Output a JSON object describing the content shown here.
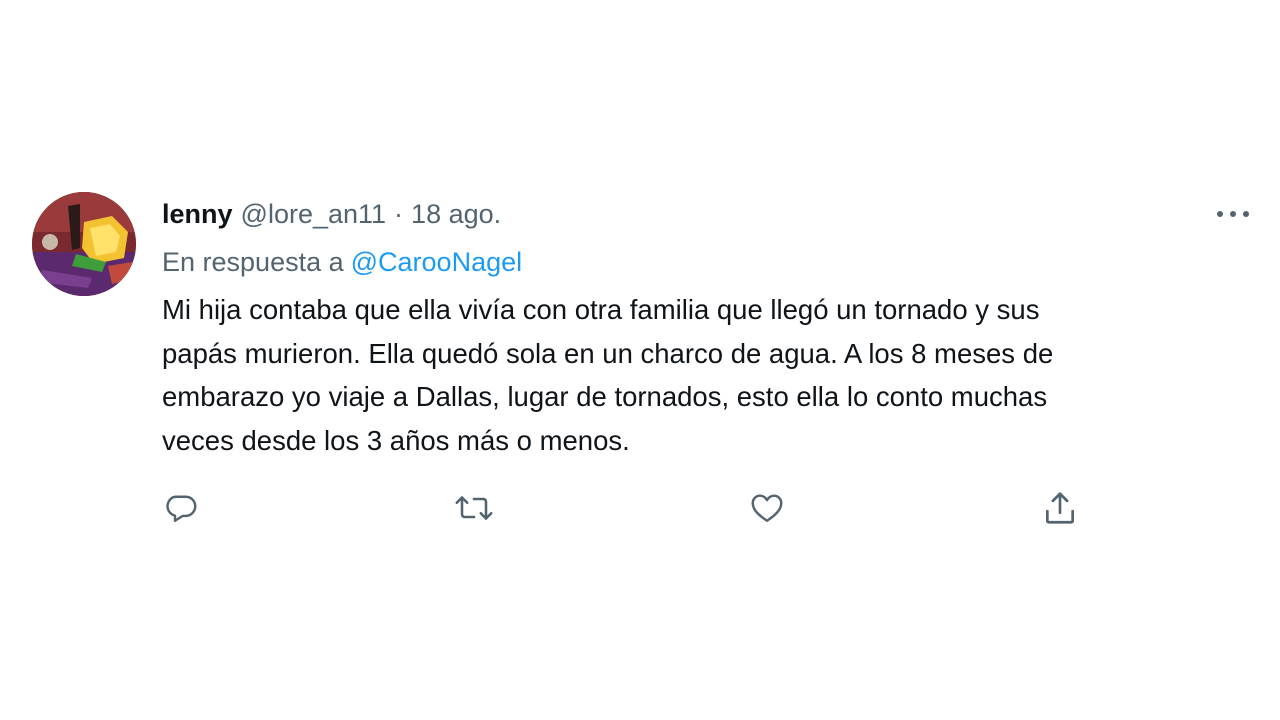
{
  "tweet": {
    "author": {
      "display_name": "lenny",
      "handle": "@lore_an11"
    },
    "separator": "·",
    "date": "18 ago.",
    "reply_prefix": "En respuesta a",
    "reply_to": "@CarooNagel",
    "text": "Mi hija contaba que ella vivía con otra familia que llegó un tornado y sus\npapás murieron. Ella quedó sola en un charco de agua.  A los 8 meses de\nembarazo yo viaje a Dallas, lugar de tornados, esto ella lo conto muchas\nveces desde los 3 años más o menos."
  },
  "icons": {
    "more": "more-horizontal-icon",
    "reply": "reply-bubble-icon",
    "retweet": "retweet-icon",
    "like": "heart-icon",
    "share": "share-upload-icon"
  },
  "colors": {
    "text_primary": "#0f1419",
    "text_secondary": "#536471",
    "link": "#1d9bf0"
  }
}
